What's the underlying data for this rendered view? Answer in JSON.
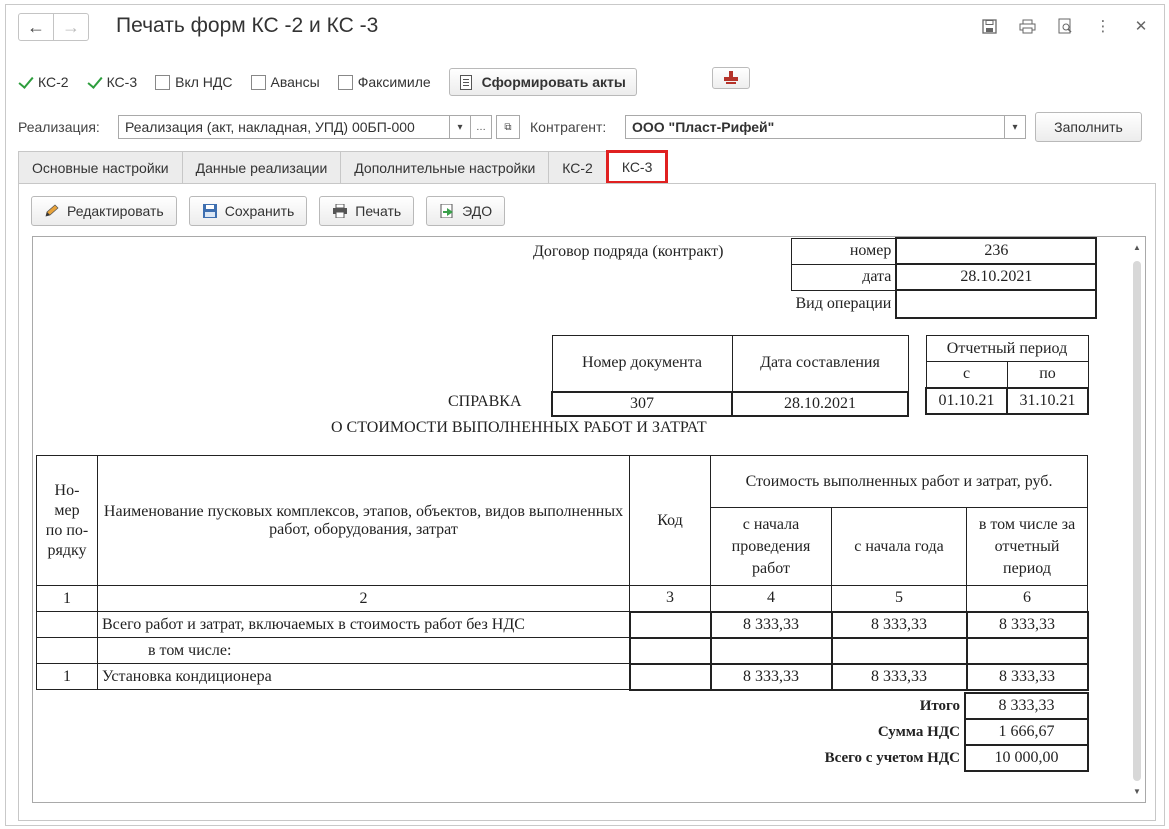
{
  "window": {
    "title": "Печать форм КС -2 и КС -3"
  },
  "options": {
    "ks2": "КС-2",
    "ks3": "КС-3",
    "vat": "Вкл НДС",
    "advances": "Авансы",
    "facsimile": "Факсимиле",
    "generate_button": "Сформировать акты"
  },
  "filters": {
    "sale_label": "Реализация:",
    "sale_value": "Реализация (акт, накладная, УПД) 00БП-000",
    "counterparty_label": "Контрагент:",
    "counterparty_value": "ООО \"Пласт-Рифей\"",
    "fill_button": "Заполнить"
  },
  "tabs": [
    "Основные настройки",
    "Данные реализации",
    "Дополнительные настройки",
    "КС-2",
    "КС-3"
  ],
  "active_tab": "КС-3",
  "toolbar": {
    "edit": "Редактировать",
    "save": "Сохранить",
    "print": "Печать",
    "edo": "ЭДО"
  },
  "document": {
    "contract_label": "Договор подряда (контракт)",
    "number_label": "номер",
    "number_value": "236",
    "date_label": "дата",
    "date_value": "28.10.2021",
    "operation_label": "Вид операции",
    "operation_value": "",
    "doc_number_header": "Номер документа",
    "doc_date_header": "Дата составления",
    "period_header": "Отчетный период",
    "period_from_header": "с",
    "period_to_header": "по",
    "cert_title": "СПРАВКА",
    "doc_number": "307",
    "doc_date": "28.10.2021",
    "period_from": "01.10.21",
    "period_to": "31.10.21",
    "subtitle": "О СТОИМОСТИ ВЫПОЛНЕННЫХ РАБОТ И ЗАТРАТ",
    "headers": {
      "num": "Но-\nмер\nпо по-\nрядку",
      "name": "Наименование пусковых комплексов, этапов, объектов, видов выполненных работ, оборудования, затрат",
      "code": "Код",
      "cost_group": "Стоимость выполненных работ и затрат, руб.",
      "from_start": "с начала проведения работ",
      "from_year": "с начала года",
      "period": "в том числе за отчетный период"
    },
    "col_numbers": [
      "1",
      "2",
      "3",
      "4",
      "5",
      "6"
    ],
    "rows": [
      {
        "num": "",
        "name": "Всего работ и затрат, включаемых в стоимость работ без НДС",
        "code": "",
        "c4": "8 333,33",
        "c5": "8 333,33",
        "c6": "8 333,33"
      },
      {
        "num": "",
        "name": "в том числе:",
        "code": "",
        "c4": "",
        "c5": "",
        "c6": ""
      },
      {
        "num": "1",
        "name": "Установка кондиционера",
        "code": "",
        "c4": "8 333,33",
        "c5": "8 333,33",
        "c6": "8 333,33"
      }
    ],
    "totals": {
      "itogo_label": "Итого",
      "itogo_value": "8 333,33",
      "vat_label": "Сумма НДС",
      "vat_value": "1 666,67",
      "total_label": "Всего с учетом НДС",
      "total_value": "10 000,00"
    }
  }
}
